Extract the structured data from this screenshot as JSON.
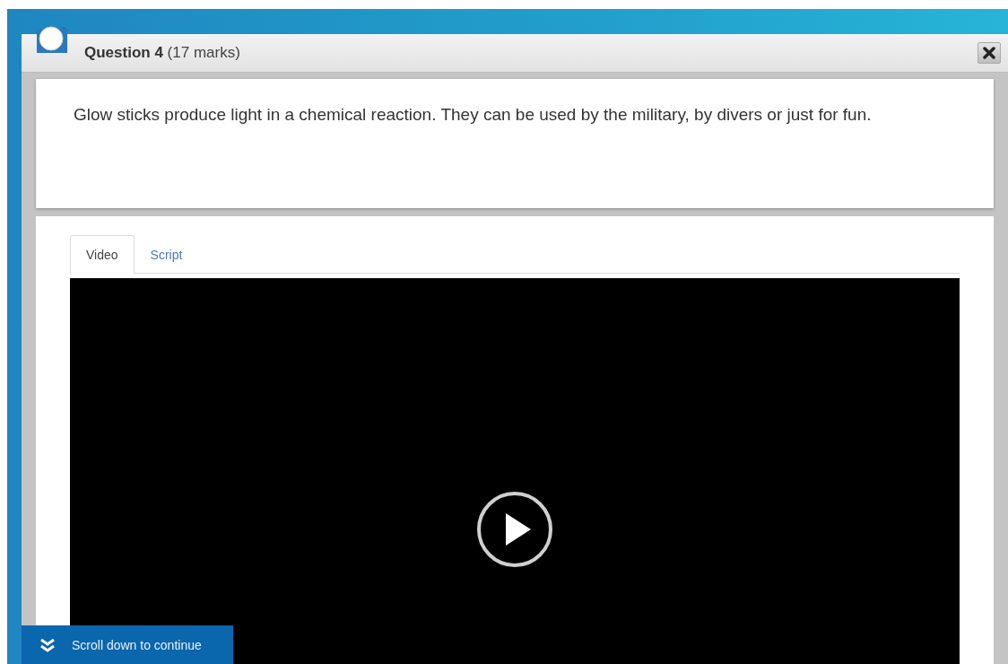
{
  "dialog": {
    "title": "Question 4",
    "marks": "(17 marks)"
  },
  "question": {
    "text": "Glow sticks produce light in a chemical reaction. They can be used by the military, by divers or just for fun."
  },
  "tabs": [
    {
      "label": "Video",
      "selected": true
    },
    {
      "label": "Script",
      "selected": false
    }
  ],
  "scroll_hint": {
    "label": "Scroll down to continue"
  }
}
